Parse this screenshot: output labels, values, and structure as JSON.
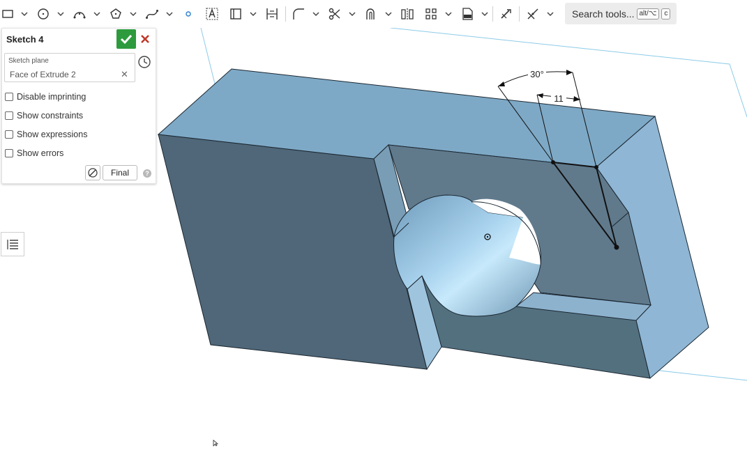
{
  "toolbar": {
    "tools": [
      {
        "name": "rectangle-icon",
        "has_dropdown": true
      },
      {
        "name": "circle-icon",
        "has_dropdown": true
      },
      {
        "name": "arc-icon",
        "has_dropdown": true
      },
      {
        "name": "polygon-icon",
        "has_dropdown": true
      },
      {
        "name": "spline-icon",
        "has_dropdown": true
      },
      {
        "name": "point-icon",
        "has_dropdown": false
      },
      {
        "name": "text-icon",
        "has_dropdown": false
      },
      {
        "name": "construction-icon",
        "has_dropdown": true
      },
      {
        "name": "midpoint-icon",
        "has_dropdown": false
      },
      {
        "name": "fillet-icon",
        "has_dropdown": true
      },
      {
        "name": "trim-icon",
        "has_dropdown": true
      },
      {
        "name": "offset-icon",
        "has_dropdown": true
      },
      {
        "name": "mirror-icon",
        "has_dropdown": false
      },
      {
        "name": "pattern-icon",
        "has_dropdown": true
      },
      {
        "name": "dxf-import-icon",
        "has_dropdown": true
      },
      {
        "name": "use-edge-icon",
        "has_dropdown": false
      },
      {
        "name": "constraint-icon",
        "has_dropdown": true
      }
    ],
    "search": {
      "label": "Search tools...",
      "shortcut_mod": "alt/⌥",
      "shortcut_key": "c"
    }
  },
  "sketch_panel": {
    "title": "Sketch 4",
    "sketch_plane_label": "Sketch plane",
    "sketch_plane_value": "Face of Extrude 2",
    "options": [
      {
        "label": "Disable imprinting",
        "checked": false
      },
      {
        "label": "Show constraints",
        "checked": false
      },
      {
        "label": "Show expressions",
        "checked": false
      },
      {
        "label": "Show errors",
        "checked": false
      }
    ],
    "final_label": "Final",
    "help_label": "?"
  },
  "viewport": {
    "dimension_angle": "30°",
    "dimension_length": "11"
  },
  "colors": {
    "accept": "#2d9b3d",
    "cancel": "#c0392b",
    "part_top": "#7ea9c6",
    "part_front": "#4f6778",
    "part_side": "#8fb6d4",
    "plane_outline": "#8ccbe8"
  }
}
